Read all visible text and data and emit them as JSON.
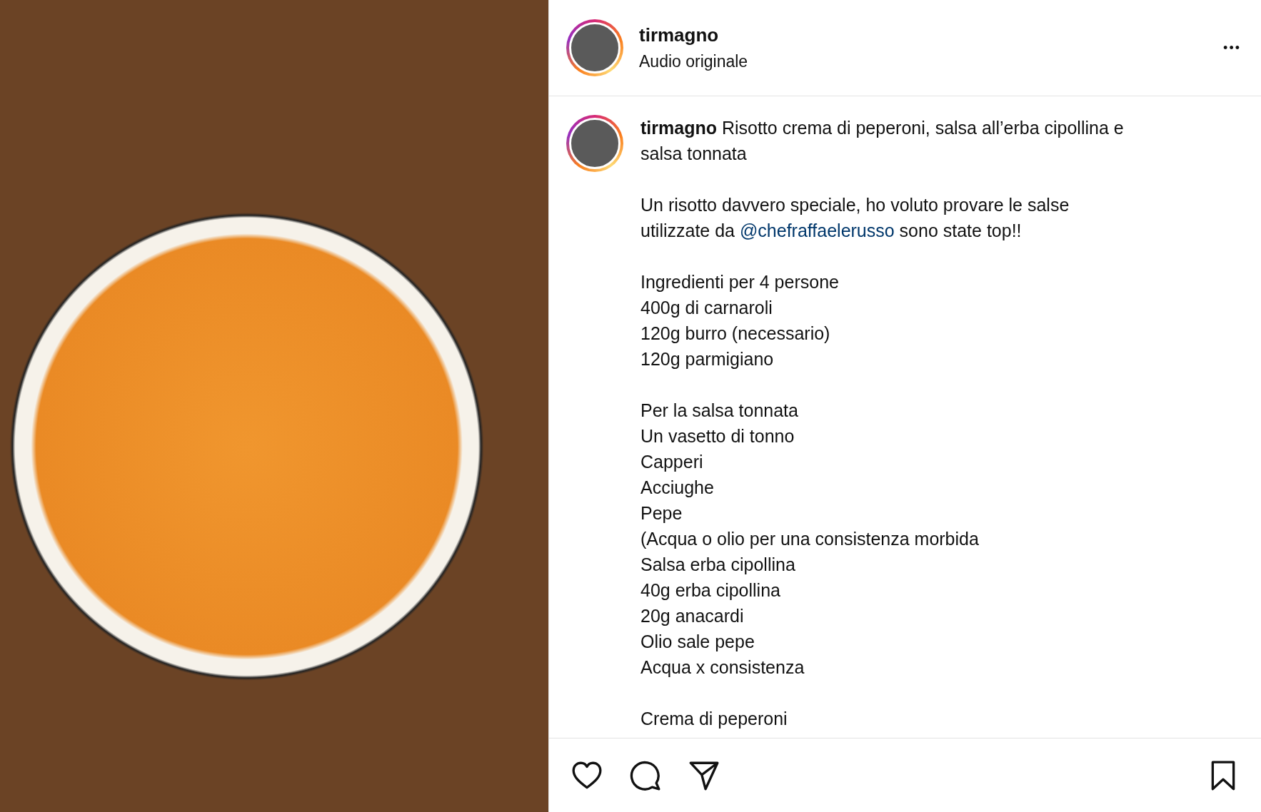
{
  "header": {
    "username": "tirmagno",
    "subtitle": "Audio originale",
    "more": "•••"
  },
  "caption": {
    "paragraphs": [
      {
        "segments": [
          {
            "kind": "author",
            "text": "tirmagno"
          },
          {
            "kind": "text",
            "text": " Risotto crema di peperoni, salsa all’erba cipollina e salsa tonnata"
          }
        ]
      },
      {
        "segments": [
          {
            "kind": "text",
            "text": "Un risotto davvero speciale, ho voluto provare le salse utilizzate da "
          },
          {
            "kind": "mention",
            "text": "@chefraffaelerusso"
          },
          {
            "kind": "text",
            "text": " sono state top!!"
          }
        ]
      },
      {
        "segments": [
          {
            "kind": "text",
            "text": "Ingredienti per 4 persone\n400g di carnaroli\n120g burro (necessario)\n120g parmigiano"
          }
        ]
      },
      {
        "segments": [
          {
            "kind": "text",
            "text": "Per la salsa tonnata\nUn vasetto di tonno\nCapperi\nAcciughe\nPepe\n(Acqua o olio per una consistenza morbida\nSalsa erba cipollina\n40g erba cipollina\n20g anacardi\nOlio sale pepe\nAcqua x consistenza"
          }
        ]
      },
      {
        "segments": [
          {
            "kind": "text",
            "text": "Crema di peperoni"
          }
        ]
      }
    ]
  },
  "actions": [
    {
      "kind": "like"
    },
    {
      "kind": "comment"
    },
    {
      "kind": "share"
    },
    {
      "kind": "save"
    }
  ]
}
